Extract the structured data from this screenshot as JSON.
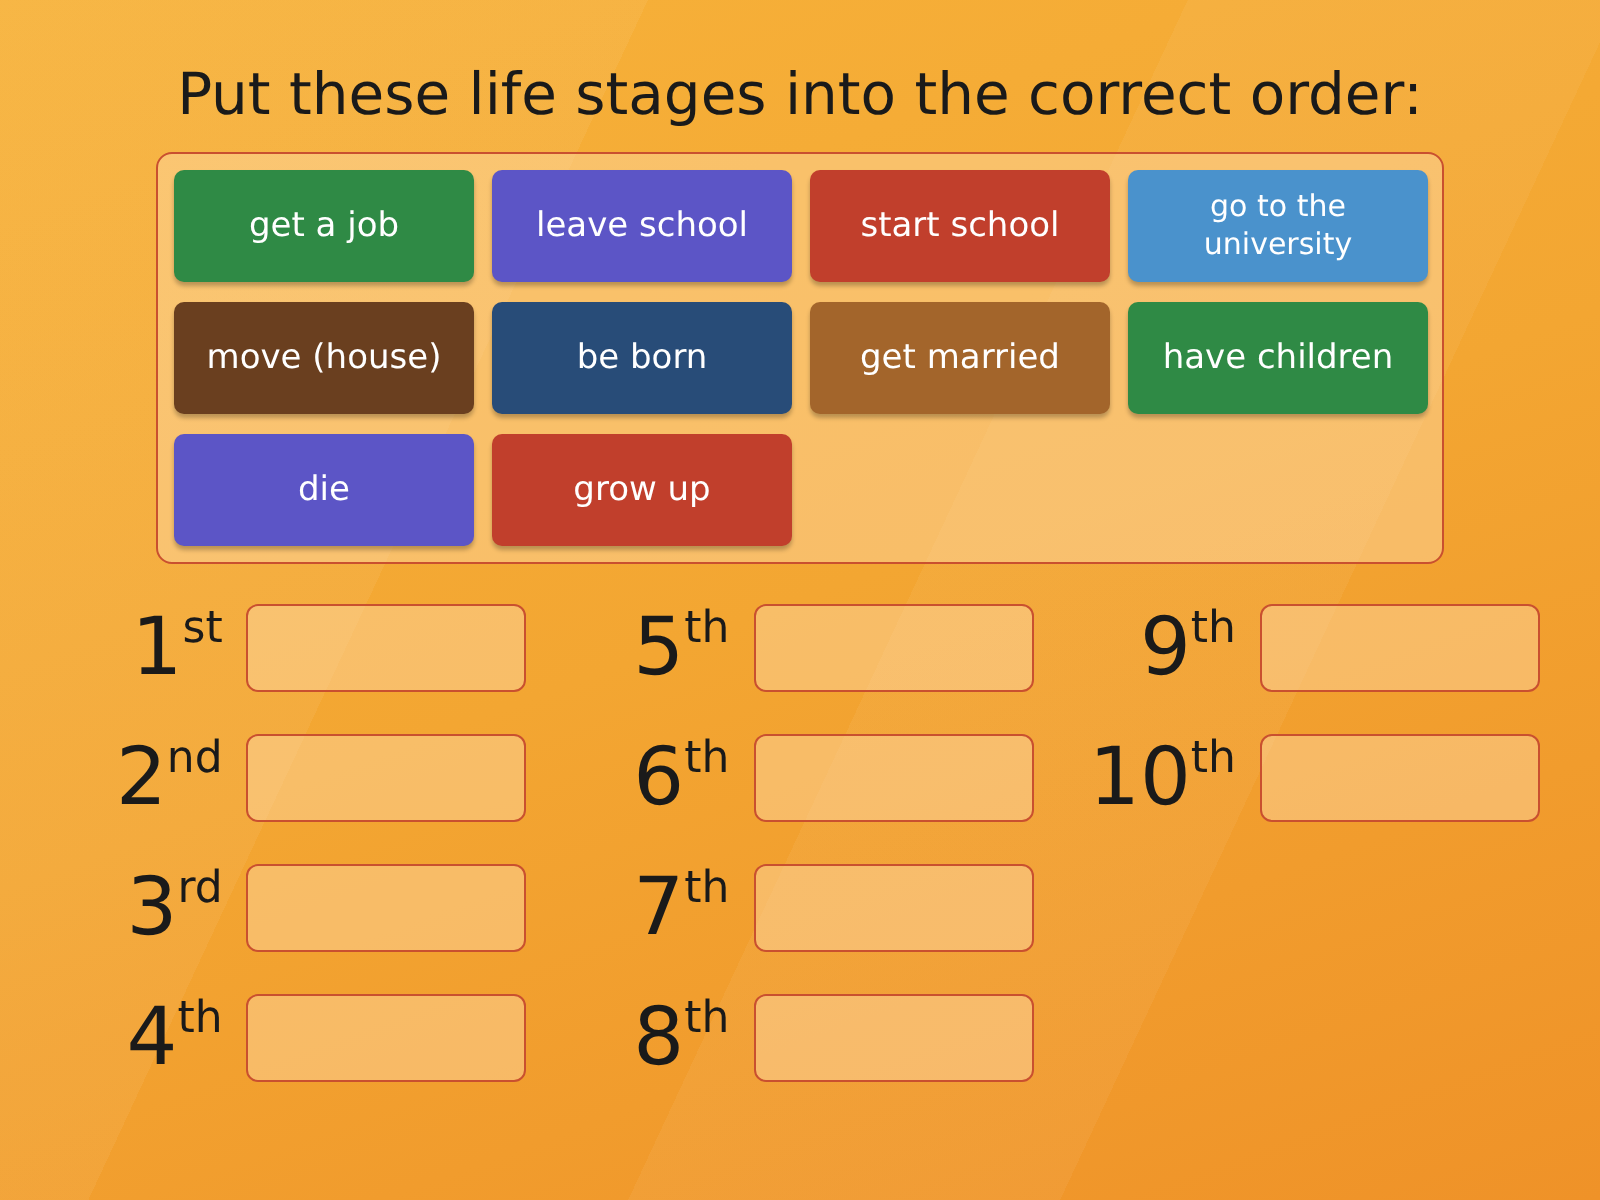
{
  "title": "Put these life stages into the correct order:",
  "tiles": [
    {
      "label": "get a job",
      "color": "#2f8a45"
    },
    {
      "label": "leave school",
      "color": "#5c55c6"
    },
    {
      "label": "start school",
      "color": "#c13f2c"
    },
    {
      "label": "go to the university",
      "color": "#4a92cc"
    },
    {
      "label": "move (house)",
      "color": "#6a3f1f"
    },
    {
      "label": "be born",
      "color": "#284c78"
    },
    {
      "label": "get married",
      "color": "#a3652b"
    },
    {
      "label": "have children",
      "color": "#2f8a45"
    },
    {
      "label": "die",
      "color": "#5c55c6"
    },
    {
      "label": "grow up",
      "color": "#c13f2c"
    }
  ],
  "slot_columns": [
    [
      {
        "ordinal": "1$^{st}$"
      },
      {
        "ordinal": "2$^{nd}$"
      },
      {
        "ordinal": "3$^{rd}$"
      },
      {
        "ordinal": "4$^{th}$"
      }
    ],
    [
      {
        "ordinal": "5$^{th}$"
      },
      {
        "ordinal": "6$^{th}$"
      },
      {
        "ordinal": "7$^{th}$"
      },
      {
        "ordinal": "8$^{th}$"
      }
    ],
    [
      {
        "ordinal": "9$^{th}$"
      },
      {
        "ordinal": "10$^{th}$"
      }
    ]
  ]
}
